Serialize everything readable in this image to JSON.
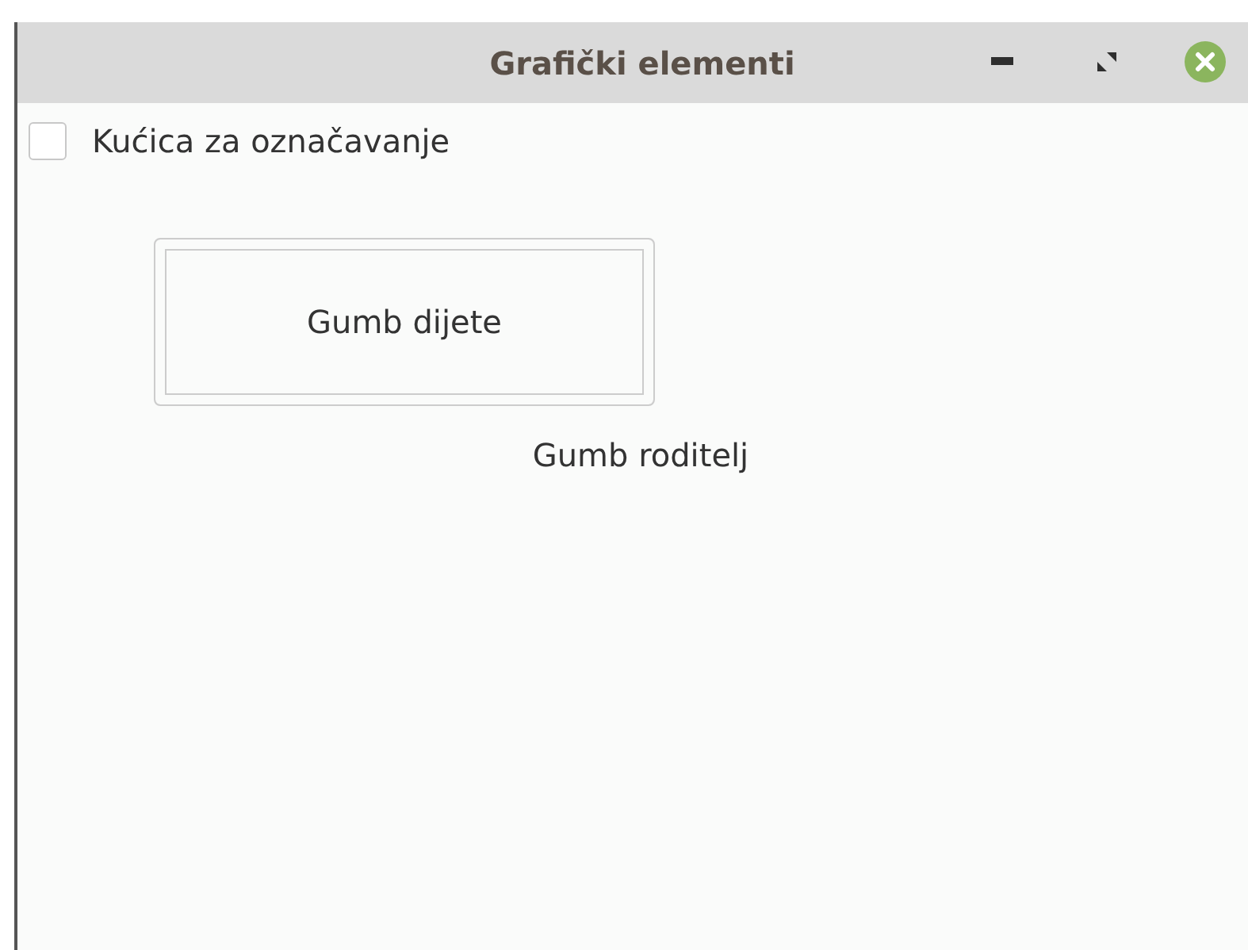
{
  "window": {
    "title": "Grafički elementi"
  },
  "checkbox": {
    "label": "Kućica za označavanje",
    "checked": false
  },
  "parent_button": {
    "label": "Gumb roditelj"
  },
  "child_button": {
    "label": "Gumb dijete"
  }
}
